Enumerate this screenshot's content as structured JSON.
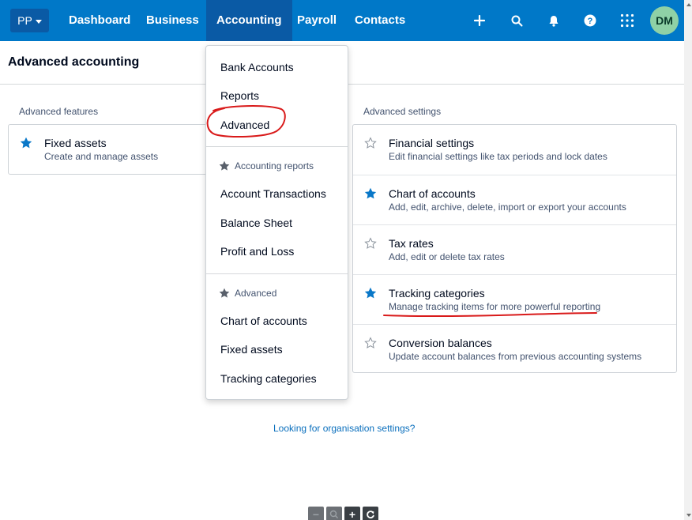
{
  "nav": {
    "org_label": "PP",
    "items": [
      "Dashboard",
      "Business",
      "Accounting",
      "Payroll",
      "Contacts"
    ],
    "active": "Accounting",
    "avatar_initials": "DM",
    "icons": [
      "plus-icon",
      "search-icon",
      "bell-icon",
      "help-icon",
      "app-grid-icon"
    ]
  },
  "page": {
    "title": "Advanced accounting"
  },
  "features": {
    "label": "Advanced features",
    "items": [
      {
        "title": "Fixed assets",
        "desc": "Create and manage assets",
        "starred": true
      }
    ]
  },
  "settings": {
    "label": "Advanced settings",
    "items": [
      {
        "title": "Financial settings",
        "desc": "Edit financial settings like tax periods and lock dates",
        "starred": false
      },
      {
        "title": "Chart of accounts",
        "desc": "Add, edit, archive, delete, import or export your accounts",
        "starred": true
      },
      {
        "title": "Tax rates",
        "desc": "Add, edit or delete tax rates",
        "starred": false
      },
      {
        "title": "Tracking categories",
        "desc": "Manage tracking items for more powerful reporting",
        "starred": true
      },
      {
        "title": "Conversion balances",
        "desc": "Update account balances from previous accounting systems",
        "starred": false
      }
    ]
  },
  "menu": {
    "top_items": [
      "Bank Accounts",
      "Reports",
      "Advanced"
    ],
    "reports_heading": "Accounting reports",
    "reports_items": [
      "Account Transactions",
      "Balance Sheet",
      "Profit and Loss"
    ],
    "advanced_heading": "Advanced",
    "advanced_items": [
      "Chart of accounts",
      "Fixed assets",
      "Tracking categories"
    ]
  },
  "footer": {
    "link": "Looking for organisation settings?"
  },
  "colors": {
    "brand": "#0078c8",
    "brand_dark": "#0a5aa5",
    "star_filled": "#0a78c8",
    "annotation": "#d91a1a",
    "link": "#0a6fbd"
  },
  "zoom_controls": [
    "zoom-out-icon",
    "zoom-reset-icon",
    "zoom-in-icon",
    "refresh-icon"
  ]
}
